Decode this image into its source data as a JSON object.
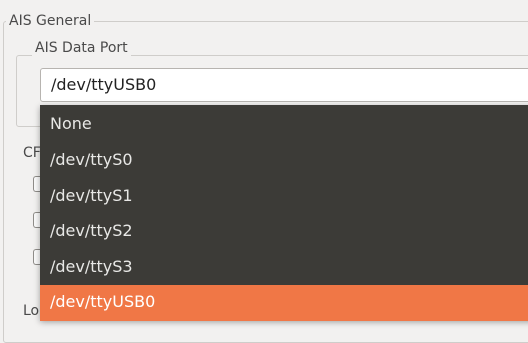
{
  "groups": {
    "general_title": "AIS General",
    "port_title": "AIS Data Port",
    "cpa_title_partial": "CF",
    "lower_title_partial": "Lo"
  },
  "combo": {
    "value": "/dev/ttyUSB0",
    "options": [
      "None",
      "/dev/ttyS0",
      "/dev/ttyS1",
      "/dev/ttyS2",
      "/dev/ttyS3",
      "/dev/ttyUSB0"
    ],
    "selected_index": 5
  },
  "colors": {
    "dropdown_bg": "#3c3b37",
    "highlight": "#f07746",
    "window_bg": "#f2f1f0"
  }
}
